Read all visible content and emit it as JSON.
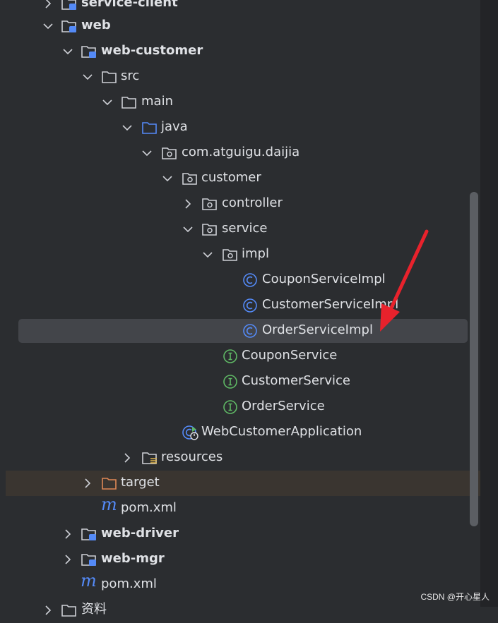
{
  "colors": {
    "background": "#2b2d30",
    "text": "#dfe1e5",
    "folder_icon": "#ced0d6",
    "source_folder_icon": "#548af7",
    "module_badge": "#548af7",
    "class_icon": "#548af7",
    "interface_icon": "#5fb865",
    "excluded_folder": "#e08855",
    "selection": "#43454a",
    "annotation_arrow": "#e8222c"
  },
  "tree": {
    "rows": [
      {
        "label": "service-client",
        "icon": "module-folder-icon",
        "arrow": "chevron-right",
        "bold": true
      },
      {
        "label": "web",
        "icon": "module-folder-icon",
        "arrow": "chevron-down",
        "bold": true
      },
      {
        "label": "web-customer",
        "icon": "module-folder-icon",
        "arrow": "chevron-down",
        "bold": true
      },
      {
        "label": "src",
        "icon": "folder-icon",
        "arrow": "chevron-down"
      },
      {
        "label": "main",
        "icon": "folder-icon",
        "arrow": "chevron-down"
      },
      {
        "label": "java",
        "icon": "source-folder-icon",
        "arrow": "chevron-down"
      },
      {
        "label": "com.atguigu.daijia",
        "icon": "package-icon",
        "arrow": "chevron-down"
      },
      {
        "label": "customer",
        "icon": "package-icon",
        "arrow": "chevron-down"
      },
      {
        "label": "controller",
        "icon": "package-icon",
        "arrow": "chevron-right"
      },
      {
        "label": "service",
        "icon": "package-icon",
        "arrow": "chevron-down"
      },
      {
        "label": "impl",
        "icon": "package-icon",
        "arrow": "chevron-down"
      },
      {
        "label": "CouponServiceImpl",
        "icon": "class-icon"
      },
      {
        "label": "CustomerServiceImpl",
        "icon": "class-icon"
      },
      {
        "label": "OrderServiceImpl",
        "icon": "class-icon",
        "selected": true
      },
      {
        "label": "CouponService",
        "icon": "interface-icon"
      },
      {
        "label": "CustomerService",
        "icon": "interface-icon"
      },
      {
        "label": "OrderService",
        "icon": "interface-icon"
      },
      {
        "label": "WebCustomerApplication",
        "icon": "spring-boot-class-icon"
      },
      {
        "label": "resources",
        "icon": "resources-folder-icon",
        "arrow": "chevron-right"
      },
      {
        "label": "target",
        "icon": "excluded-folder-icon",
        "arrow": "chevron-right"
      },
      {
        "label": "pom.xml",
        "icon": "maven-icon"
      },
      {
        "label": "web-driver",
        "icon": "module-folder-icon",
        "arrow": "chevron-right",
        "bold": true
      },
      {
        "label": "web-mgr",
        "icon": "module-folder-icon",
        "arrow": "chevron-right",
        "bold": true
      },
      {
        "label": "pom.xml",
        "icon": "maven-icon"
      },
      {
        "label": "资料",
        "icon": "folder-icon",
        "arrow": "chevron-right"
      }
    ]
  },
  "watermark": "CSDN @开心星人"
}
